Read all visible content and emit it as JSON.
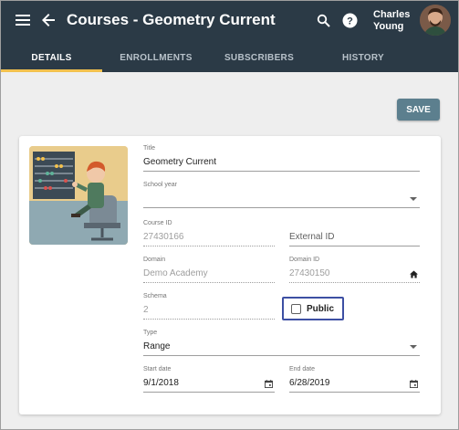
{
  "header": {
    "title": "Courses - Geometry Current",
    "user_name": "Charles Young"
  },
  "tabs": [
    {
      "label": "DETAILS",
      "active": true
    },
    {
      "label": "ENROLLMENTS",
      "active": false
    },
    {
      "label": "SUBSCRIBERS",
      "active": false
    },
    {
      "label": "HISTORY",
      "active": false
    }
  ],
  "toolbar": {
    "save_label": "SAVE"
  },
  "form": {
    "title": {
      "label": "Title",
      "value": "Geometry Current"
    },
    "school_year": {
      "label": "School year",
      "value": ""
    },
    "course_id": {
      "label": "Course ID",
      "value": "27430166"
    },
    "external_id": {
      "placeholder": "External ID"
    },
    "domain": {
      "label": "Domain",
      "value": "Demo Academy"
    },
    "domain_id": {
      "label": "Domain ID",
      "value": "27430150"
    },
    "schema": {
      "label": "Schema",
      "value": "2"
    },
    "public": {
      "label": "Public",
      "checked": false
    },
    "type": {
      "label": "Type",
      "value": "Range"
    },
    "start_date": {
      "label": "Start date",
      "value": "9/1/2018"
    },
    "end_date": {
      "label": "End date",
      "value": "6/28/2019"
    }
  },
  "colors": {
    "appbar": "#2b3a46",
    "tab_indicator": "#f2c14e",
    "save_button": "#5c7f8e",
    "highlight_border": "#3d4fa3"
  },
  "icons": {
    "menu": "menu-icon",
    "back": "arrow-back-icon",
    "search": "search-icon",
    "help": "help-icon",
    "home": "home-icon",
    "calendar": "calendar-icon"
  }
}
